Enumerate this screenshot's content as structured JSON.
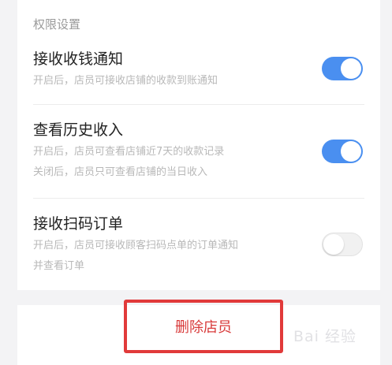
{
  "section": {
    "title": "权限设置"
  },
  "permissions": [
    {
      "title": "接收收钱通知",
      "desc": [
        "开启后，店员可接收店铺的收款到账通知"
      ],
      "enabled": true
    },
    {
      "title": "查看历史收入",
      "desc": [
        "开启后，店员可查看店铺近7天的收款记录",
        "关闭后，店员只可查看店铺的当日收入"
      ],
      "enabled": true
    },
    {
      "title": "接收扫码订单",
      "desc": [
        "开启后，店员可接收顾客扫码点单的订单通知",
        "并查看订单"
      ],
      "enabled": false
    }
  ],
  "actions": {
    "delete_label": "删除店员"
  },
  "watermark": {
    "text": "Bai 经验"
  },
  "colors": {
    "toggle_on": "#4a8ff0",
    "delete_text": "#d83a3a",
    "highlight_border": "#e13a3a"
  }
}
